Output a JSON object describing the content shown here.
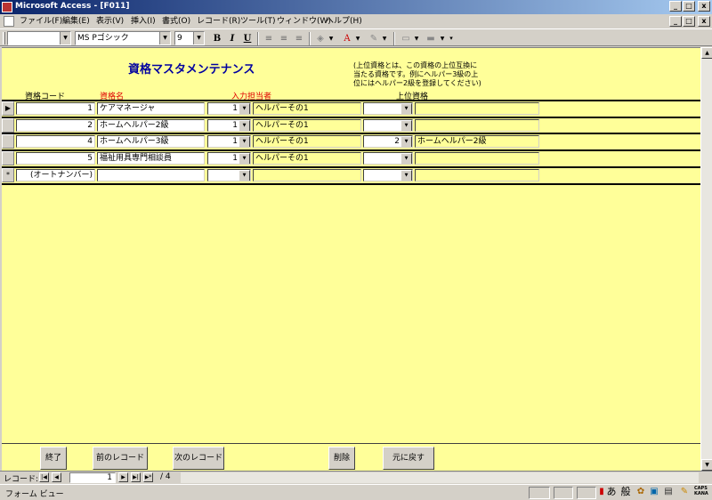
{
  "window": {
    "title": "Microsoft Access - [F011]",
    "min_glyph": "_",
    "restore_glyph": "□",
    "close_glyph": "x"
  },
  "menu": [
    "ファイル(F)",
    "編集(E)",
    "表示(V)",
    "挿入(I)",
    "書式(O)",
    "レコード(R)",
    "ツール(T)",
    "ウィンドウ(W)",
    "ヘルプ(H)"
  ],
  "toolbar": {
    "object_combo": "",
    "font_name": "MS Pゴシック",
    "font_size": "9",
    "bold": "B",
    "italic": "I",
    "underline": "U"
  },
  "form": {
    "title": "資格マスタメンテナンス",
    "note_lines": [
      "(上位資格とは、この資格の上位互換に",
      "当たる資格です。例にヘルパー3級の上",
      "位にはヘルパー2級を登録してください)"
    ],
    "headers": {
      "code": "資格コード",
      "name": "資格名",
      "staff": "入力担当者",
      "parent": "上位資格"
    },
    "records": [
      {
        "code": "1",
        "name": "ケアマネージャ",
        "staff_id": "1",
        "staff_name": "ヘルパーその1",
        "parent_id": "",
        "parent_name": ""
      },
      {
        "code": "2",
        "name": "ホームヘルパー2級",
        "staff_id": "1",
        "staff_name": "ヘルパーその1",
        "parent_id": "",
        "parent_name": ""
      },
      {
        "code": "4",
        "name": "ホームヘルパー3級",
        "staff_id": "1",
        "staff_name": "ヘルパーその1",
        "parent_id": "2",
        "parent_name": "ホームヘルパー2級"
      },
      {
        "code": "5",
        "name": "福祉用具専門相談員",
        "staff_id": "1",
        "staff_name": "ヘルパーその1",
        "parent_id": "",
        "parent_name": ""
      }
    ],
    "new_record": {
      "code_placeholder": "(オートナンバー)",
      "marker": "*"
    },
    "current_marker": "▶"
  },
  "buttons": {
    "end": "終了",
    "prev": "前のレコード",
    "next": "次のレコード",
    "delete": "削除",
    "undo": "元に戻す"
  },
  "navigation": {
    "label": "レコード:",
    "current": "1",
    "total_text": "/ 4"
  },
  "status": {
    "view": "フォーム ビュー",
    "ime_a": "あ",
    "ime_mode": "般",
    "caps": "CAPS",
    "kana": "KANA"
  }
}
